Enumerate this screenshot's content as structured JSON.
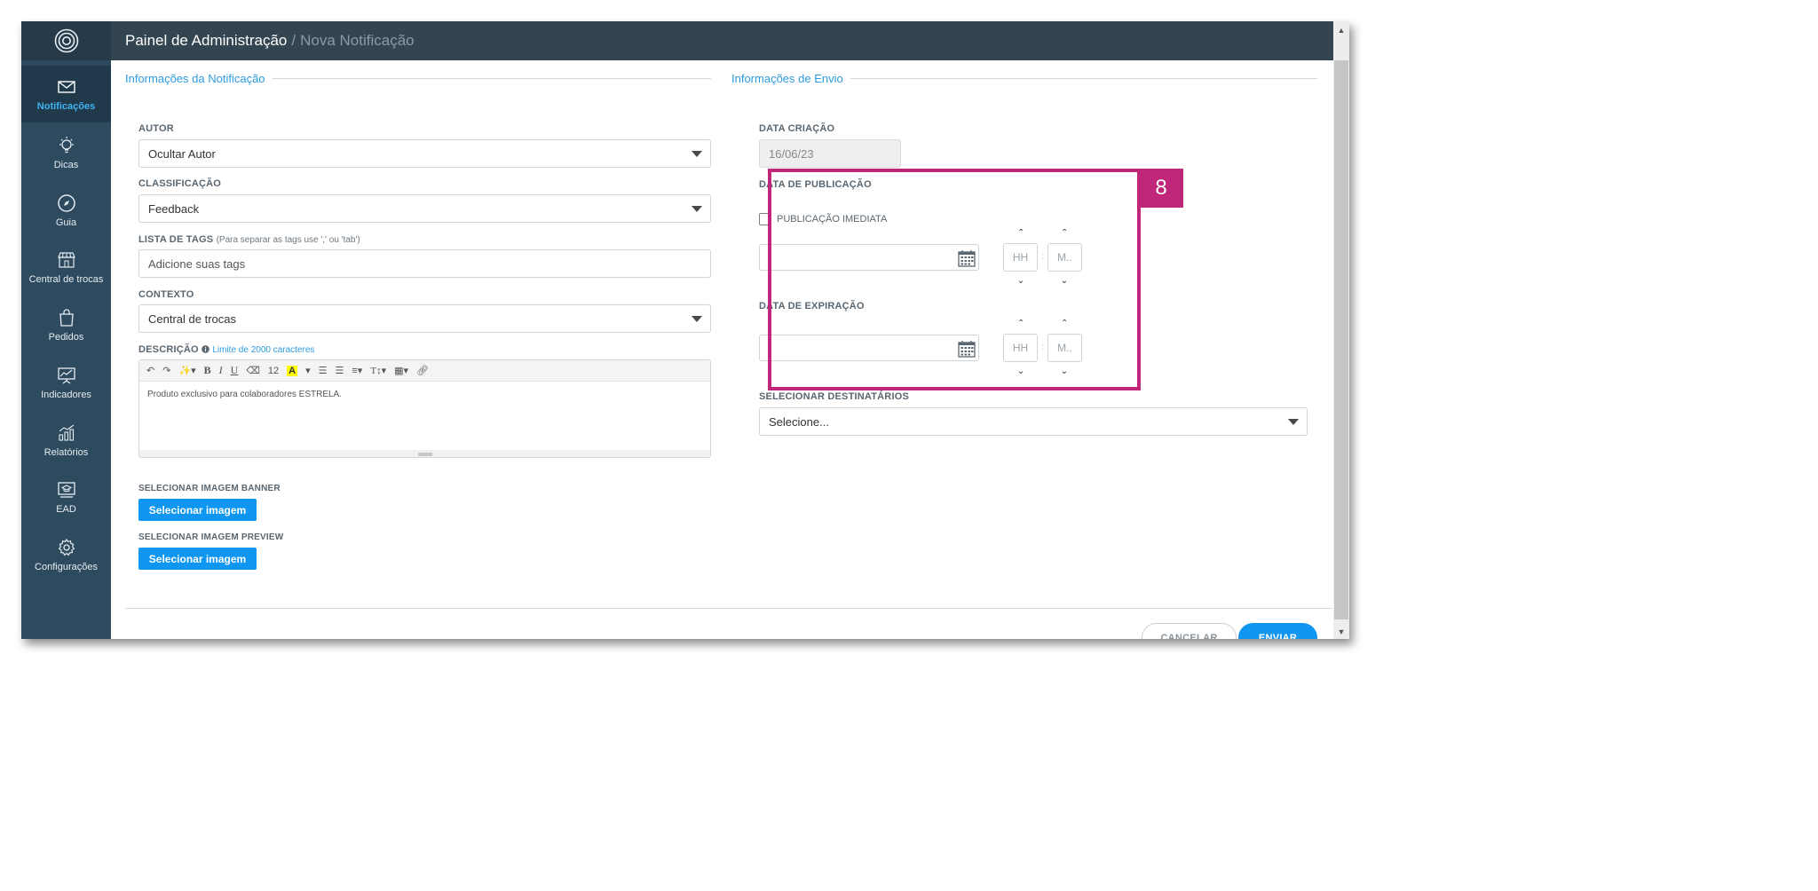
{
  "header": {
    "crumb_root": "Painel de Administração",
    "separator": "/",
    "crumb_current": "Nova Notificação"
  },
  "sidebar": {
    "items": [
      {
        "label": "Notificações",
        "icon": "envelope-icon",
        "active": true
      },
      {
        "label": "Dicas",
        "icon": "lightbulb-icon",
        "active": false
      },
      {
        "label": "Guia",
        "icon": "compass-icon",
        "active": false
      },
      {
        "label": "Central de trocas",
        "icon": "store-icon",
        "active": false
      },
      {
        "label": "Pedidos",
        "icon": "shopping-bag-icon",
        "active": false
      },
      {
        "label": "Indicadores",
        "icon": "chart-presentation-icon",
        "active": false
      },
      {
        "label": "Relatórios",
        "icon": "bar-chart-icon",
        "active": false
      },
      {
        "label": "EAD",
        "icon": "graduation-screen-icon",
        "active": false
      },
      {
        "label": "Configurações",
        "icon": "gear-icon",
        "active": false
      }
    ]
  },
  "notification_info": {
    "section_title": "Informações da Notificação",
    "author": {
      "label": "AUTOR",
      "value": "Ocultar Autor"
    },
    "classification": {
      "label": "CLASSIFICAÇÃO",
      "value": "Feedback"
    },
    "tags": {
      "label": "LISTA DE TAGS",
      "hint": "(Para separar as tags use ',' ou 'tab')",
      "placeholder": "Adicione suas tags"
    },
    "context": {
      "label": "CONTEXTO",
      "value": "Central de trocas"
    },
    "description": {
      "label": "DESCRIÇÃO",
      "limit": "Limite de 2000 caracteres",
      "font_size": "12",
      "text": "Produto exclusivo para colaboradores ESTRELA."
    },
    "banner_image": {
      "label": "SELECIONAR IMAGEM BANNER",
      "button": "Selecionar imagem"
    },
    "preview_image": {
      "label": "SELECIONAR IMAGEM PREVIEW",
      "button": "Selecionar imagem"
    }
  },
  "send_info": {
    "section_title": "Informações de Envio",
    "creation_date": {
      "label": "DATA CRIAÇÃO",
      "value": "16/06/23"
    },
    "publication": {
      "label": "DATA DE PUBLICAÇÃO",
      "immediate_label": "PUBLICAÇÃO IMEDIATA",
      "immediate_checked": false,
      "hour_placeholder": "HH",
      "minute_placeholder": "M.."
    },
    "expiration": {
      "label": "DATA DE EXPIRAÇÃO",
      "hour_placeholder": "HH",
      "minute_placeholder": "M.."
    },
    "recipients": {
      "label": "SELECIONAR DESTINATÁRIOS",
      "value": "Selecione..."
    },
    "time_separator": ":"
  },
  "callout": {
    "number": "8",
    "color": "#c0267a"
  },
  "actions": {
    "cancel": "CANCELAR",
    "send": "ENVIAR"
  },
  "colors": {
    "accent": "#0e96f0",
    "sidebar": "#2d4a5e",
    "topbar": "#344552",
    "section_title": "#2d9be0"
  }
}
